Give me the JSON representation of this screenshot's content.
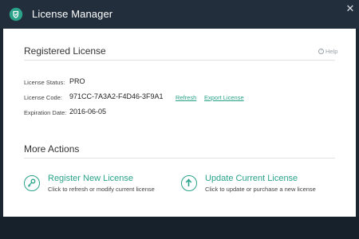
{
  "window": {
    "title": "License Manager",
    "close_glyph": "✕"
  },
  "registered": {
    "heading": "Registered License",
    "help_label": "Help",
    "help_icon": "question-circle-icon",
    "status_label": "License Status:",
    "status_value": "PRO",
    "code_label": "License Code:",
    "code_value": "971CC-7A3A2-F4D46-3F9A1",
    "refresh_link": "Refresh",
    "export_link": "Export License",
    "expiration_label": "Expiration Date:",
    "expiration_value": "2016-06-05"
  },
  "more_actions": {
    "heading": "More Actions",
    "register": {
      "title": "Register New License",
      "desc": "Click to refresh or modify current license",
      "icon": "key-icon"
    },
    "update": {
      "title": "Update Current License",
      "desc": "Click to update or purchase a new license",
      "icon": "arrow-up-icon"
    }
  },
  "colors": {
    "accent": "#2aa38a",
    "titlebar": "#222e3b",
    "footer": "#17212b"
  }
}
